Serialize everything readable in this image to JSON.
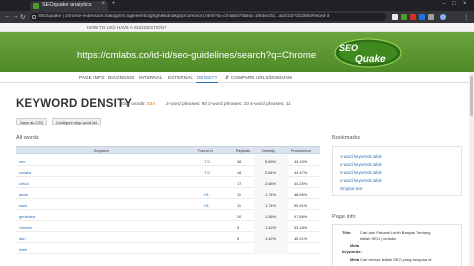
{
  "browser": {
    "tab_title": "SEOquake analytics",
    "url": "SEOquake | chrome-extension://akdgnmcogleenhbclghghlkkdndkjdjc/common.html?id=cmlabs70&fid=1f64ec0d...ab31f2?322992#word-3"
  },
  "seoquake": {
    "top_links": [
      "HOW TO USE",
      "HAVE A SUGGESTION?"
    ],
    "page_url": "https://cmlabs.co/id-id/seo-guidelines/search?q=Chrome",
    "logo_text": "SEO Quake",
    "subnav": [
      {
        "label": "PAGE INFO"
      },
      {
        "label": "DIAGNOSIS"
      },
      {
        "label": "INTERNAL"
      },
      {
        "label": "EXTERNAL"
      },
      {
        "label": "DENSITY",
        "active": true
      },
      {
        "label": "COMPARE URLS/DOMAINS"
      }
    ]
  },
  "density": {
    "title": "KEYWORD DENSITY",
    "stats": {
      "total_words_label": "Total words:",
      "total_words": "834",
      "two_word_label": "2-word phrases:",
      "two_word": "60",
      "three_word_label": "3-word phrases:",
      "three_word": "23",
      "four_word_label": "4-word phrases:",
      "four_word": "11"
    },
    "buttons": [
      "Save as CSV",
      "Configure stop-word list"
    ],
    "section_label": "All words",
    "columns": [
      "Keyword",
      "Found in",
      "Repeats",
      "Density",
      "Prominence"
    ],
    "rows": [
      {
        "keyword": "seo",
        "found": "T D",
        "repeats": "38",
        "density": "5.89%",
        "prominence": "44.15%"
      },
      {
        "keyword": "cmlabs",
        "found": "T D",
        "repeats": "18",
        "density": "2.84%",
        "prominence": "44.47%"
      },
      {
        "keyword": "untuk",
        "found": "",
        "repeats": "17",
        "density": "2.68%",
        "prominence": "44.25%"
      },
      {
        "keyword": "anda",
        "found": "H1",
        "repeats": "11",
        "density": "1.74%",
        "prominence": "48.89%"
      },
      {
        "keyword": "kami",
        "found": "H1",
        "repeats": "11",
        "density": "1.74%",
        "prominence": "50.91%"
      },
      {
        "keyword": "generator",
        "found": "",
        "repeats": "10",
        "density": "1.58%",
        "prominence": "47.86%"
      },
      {
        "keyword": "checker",
        "found": "",
        "repeats": "9",
        "density": "1.42%",
        "prominence": "33.18%"
      },
      {
        "keyword": "dan",
        "found": "",
        "repeats": "9",
        "density": "1.42%",
        "prominence": "45.21%"
      },
      {
        "keyword": "lebih",
        "found": "",
        "repeats": "",
        "density": "",
        "prominence": ""
      }
    ]
  },
  "bookmarks": {
    "title": "Bookmarks",
    "links": [
      "1-word keywords table",
      "2-word keywords table",
      "3-word keywords table",
      "4-word keywords table",
      "Original text"
    ]
  },
  "page_info": {
    "title": "Page info",
    "title_key": "Title:",
    "title_val_1": "Cari dan Pahami Lebih Banyak Tentang",
    "title_val_2": "Istilah SEO | cmlabs",
    "meta_key_1": "Meta",
    "meta_key_2": "keywords:",
    "desc_key": "Meta",
    "desc_val": "Cari semua Istilah SEO yang berguna di"
  }
}
